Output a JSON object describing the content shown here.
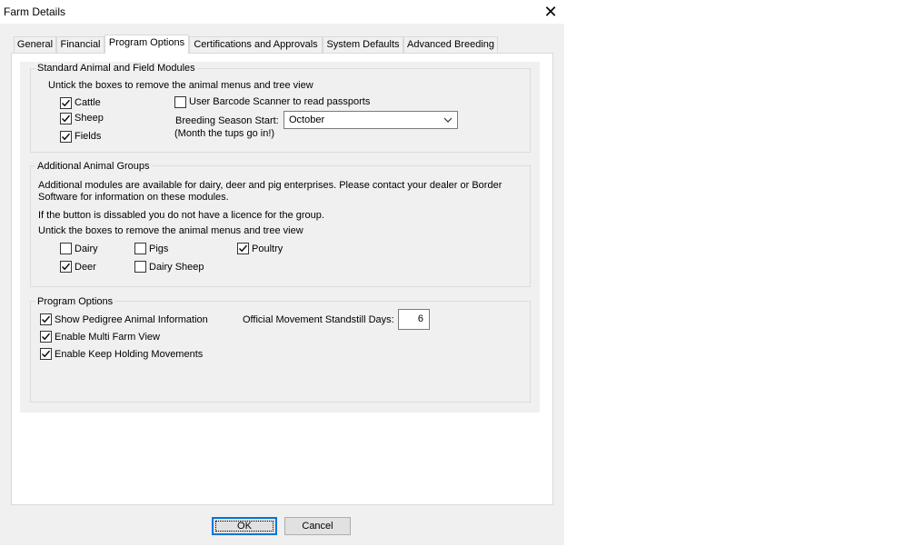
{
  "window": {
    "title": "Farm Details"
  },
  "tabs": [
    "General",
    "Financial",
    "Program Options",
    "Certifications and Approvals",
    "System Defaults",
    "Advanced Breeding"
  ],
  "standard_modules": {
    "title": "Standard Animal and Field Modules",
    "instruction": "Untick the boxes to remove the animal menus and tree view",
    "cattle": {
      "label": "Cattle",
      "checked": true
    },
    "sheep": {
      "label": "Sheep",
      "checked": true
    },
    "fields": {
      "label": "Fields",
      "checked": true
    },
    "barcode": {
      "label": "User Barcode Scanner to read passports",
      "checked": false
    },
    "breeding_season_label": "Breeding Season Start:",
    "breeding_season_note": "(Month the tups go in!)",
    "breeding_season_value": "October"
  },
  "additional_groups": {
    "title": "Additional Animal Groups",
    "info_line1": "Additional modules are available for dairy, deer and pig enterprises. Please contact your dealer or Border",
    "info_line2": "Software for information on these modules.",
    "licence_note": "If the button is dissabled you do not have a licence for the group.",
    "instruction": "Untick the boxes to remove the animal menus and tree view",
    "dairy": {
      "label": "Dairy",
      "checked": false
    },
    "pigs": {
      "label": "Pigs",
      "checked": false
    },
    "poultry": {
      "label": "Poultry",
      "checked": true
    },
    "deer": {
      "label": "Deer",
      "checked": true
    },
    "dairy_sheep": {
      "label": "Dairy Sheep",
      "checked": false
    }
  },
  "program_options": {
    "title": "Program Options",
    "pedigree": {
      "label": "Show Pedigree Animal Information",
      "checked": true
    },
    "multi_farm": {
      "label": "Enable Multi Farm View",
      "checked": true
    },
    "keep_holding": {
      "label": "Enable Keep Holding Movements",
      "checked": true
    },
    "standstill_label": "Official Movement Standstill Days:",
    "standstill_value": "6"
  },
  "buttons": {
    "ok": "OK",
    "cancel": "Cancel"
  }
}
